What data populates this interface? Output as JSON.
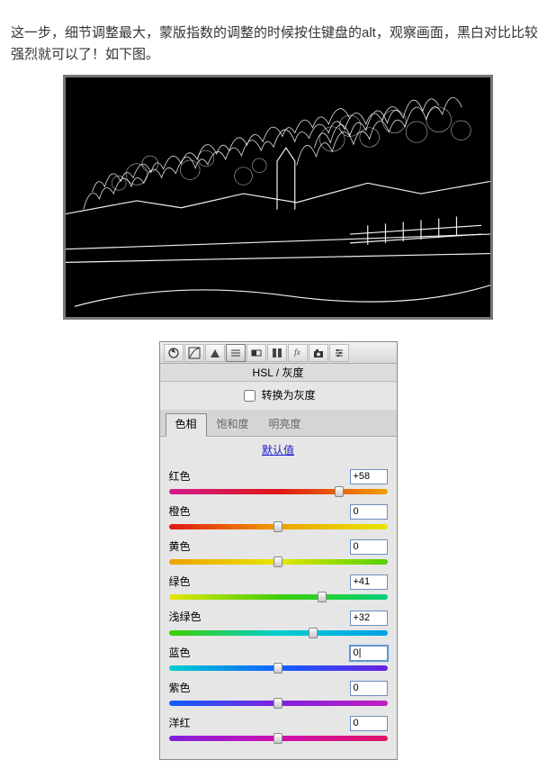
{
  "intro_text": "这一步，细节调整最大，蒙版指数的调整的时候按住键盘的alt，观察画面，黑白对比比较强烈就可以了！如下图。",
  "panel": {
    "title": "HSL / 灰度",
    "checkbox_label": "转换为灰度",
    "checkbox_checked": false,
    "tabs": {
      "hue": "色相",
      "sat": "饱和度",
      "lum": "明亮度",
      "active": "hue"
    },
    "default_link": "默认值",
    "sliders": [
      {
        "id": "red",
        "label": "红色",
        "value": "+58",
        "thumb_pct": 78,
        "gradient": "linear-gradient(90deg,#d11b8d,#e01515,#f0a000)"
      },
      {
        "id": "orange",
        "label": "橙色",
        "value": "0",
        "thumb_pct": 50,
        "gradient": "linear-gradient(90deg,#e01515,#f0a000,#e6e600)"
      },
      {
        "id": "yellow",
        "label": "黄色",
        "value": "0",
        "thumb_pct": 50,
        "gradient": "linear-gradient(90deg,#f0a000,#e6e600,#4fd000)"
      },
      {
        "id": "green",
        "label": "绿色",
        "value": "+41",
        "thumb_pct": 70,
        "gradient": "linear-gradient(90deg,#e6e600,#3fcf00,#00d080)"
      },
      {
        "id": "aqua",
        "label": "浅绿色",
        "value": "+32",
        "thumb_pct": 66,
        "gradient": "linear-gradient(90deg,#3fcf00,#00cfcf,#009fe8)"
      },
      {
        "id": "blue",
        "label": "蓝色",
        "value": "0|",
        "thumb_pct": 50,
        "gradient": "linear-gradient(90deg,#00cfcf,#1060ff,#6a20e0)",
        "focus": true
      },
      {
        "id": "purple",
        "label": "紫色",
        "value": "0",
        "thumb_pct": 50,
        "gradient": "linear-gradient(90deg,#1060ff,#8020e0,#c020c0)"
      },
      {
        "id": "magenta",
        "label": "洋红",
        "value": "0",
        "thumb_pct": 50,
        "gradient": "linear-gradient(90deg,#8020e0,#d010b0,#e01565)"
      }
    ]
  }
}
